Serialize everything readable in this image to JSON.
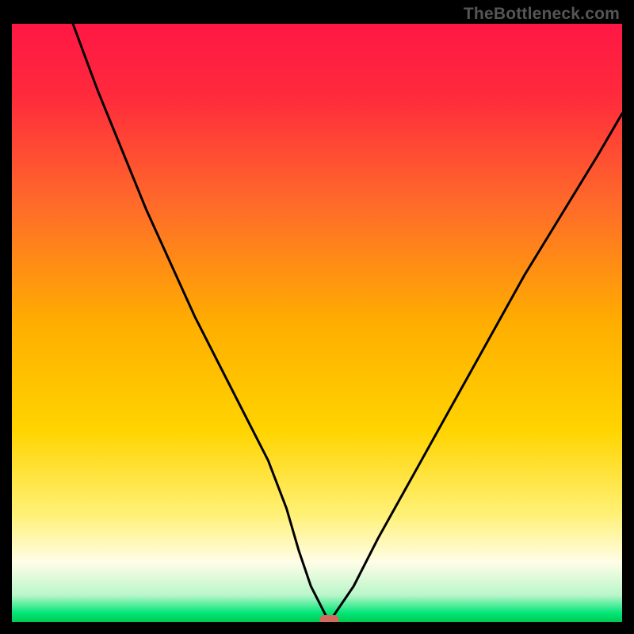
{
  "attribution": "TheBottleneck.com",
  "chart_data": {
    "type": "line",
    "title": "",
    "xlabel": "",
    "ylabel": "",
    "xlim": [
      0,
      100
    ],
    "ylim": [
      0,
      100
    ],
    "gradient_stops": [
      {
        "offset": 0.0,
        "color": "#ff1744"
      },
      {
        "offset": 0.12,
        "color": "#ff2a3c"
      },
      {
        "offset": 0.3,
        "color": "#ff6a2a"
      },
      {
        "offset": 0.5,
        "color": "#ffae00"
      },
      {
        "offset": 0.68,
        "color": "#ffd400"
      },
      {
        "offset": 0.82,
        "color": "#fff176"
      },
      {
        "offset": 0.9,
        "color": "#fffde7"
      },
      {
        "offset": 0.955,
        "color": "#b9f6ca"
      },
      {
        "offset": 0.985,
        "color": "#00e676"
      },
      {
        "offset": 1.0,
        "color": "#00c853"
      }
    ],
    "series": [
      {
        "name": "bottleneck-curve",
        "x": [
          10,
          14,
          18,
          22,
          26,
          30,
          34,
          38,
          42,
          45,
          47,
          49,
          51,
          52,
          56,
          60,
          66,
          72,
          78,
          84,
          90,
          96,
          100
        ],
        "values": [
          100,
          89,
          79,
          69,
          60,
          51,
          43,
          35,
          27,
          19,
          12,
          6,
          2,
          0,
          6,
          14,
          25,
          36,
          47,
          58,
          68,
          78,
          85
        ]
      }
    ],
    "marker": {
      "name": "optimal-point",
      "x": 52,
      "y": 0,
      "color": "#d46a5e"
    }
  }
}
